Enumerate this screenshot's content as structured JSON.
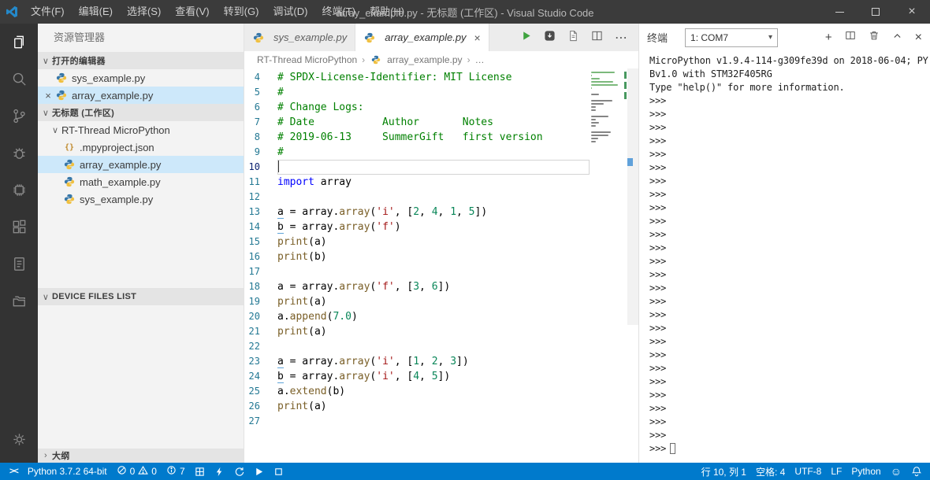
{
  "titlebar": {
    "menus": [
      "文件(F)",
      "编辑(E)",
      "选择(S)",
      "查看(V)",
      "转到(G)",
      "调试(D)",
      "终端(T)",
      "帮助(H)"
    ],
    "title": "array_example.py - 无标题 (工作区) - Visual Studio Code"
  },
  "icons": {
    "close": "×",
    "chevron_down": "∨",
    "chevron_right": "›",
    "breadcrumb_sep": "›",
    "more": "⋯",
    "dropdown_arrow": "▾",
    "json_braces": "{}",
    "plus": "+",
    "smiley": "☺",
    "remote": "><"
  },
  "sidebar": {
    "title": "资源管理器",
    "open_editors": {
      "label": "打开的编辑器",
      "items": [
        {
          "name": "sys_example.py"
        },
        {
          "name": "array_example.py",
          "active": true
        }
      ]
    },
    "workspace": {
      "label": "无标题 (工作区)",
      "folder": "RT-Thread MicroPython",
      "files": [
        ".mpyproject.json",
        "array_example.py",
        "math_example.py",
        "sys_example.py"
      ],
      "selected": "array_example.py"
    },
    "device_section": {
      "label": "DEVICE FILES LIST"
    },
    "outline_section": {
      "label": "大纲"
    }
  },
  "editor": {
    "tabs": [
      {
        "label": "sys_example.py",
        "active": false
      },
      {
        "label": "array_example.py",
        "active": true
      }
    ],
    "breadcrumbs": [
      "RT-Thread MicroPython",
      "array_example.py",
      "…"
    ],
    "code": {
      "first_line": 4,
      "current_line": 10,
      "lines": [
        [
          {
            "t": "cm",
            "s": "# SPDX-License-Identifier: MIT License"
          }
        ],
        [
          {
            "t": "cm",
            "s": "#"
          }
        ],
        [
          {
            "t": "cm",
            "s": "# Change Logs:"
          }
        ],
        [
          {
            "t": "cm",
            "s": "# Date           Author       Notes"
          }
        ],
        [
          {
            "t": "cm",
            "s": "# 2019-06-13     SummerGift   first version"
          }
        ],
        [
          {
            "t": "cm",
            "s": "#"
          }
        ],
        [],
        [
          {
            "t": "kw",
            "s": "import"
          },
          {
            "t": "pl",
            "s": " array"
          }
        ],
        [],
        [
          {
            "t": "pl",
            "s": "a",
            "u": true
          },
          {
            "t": "pl",
            "s": " = array."
          },
          {
            "t": "fn",
            "s": "array"
          },
          {
            "t": "pl",
            "s": "("
          },
          {
            "t": "str",
            "s": "'i'"
          },
          {
            "t": "pl",
            "s": ", ["
          },
          {
            "t": "num",
            "s": "2"
          },
          {
            "t": "pl",
            "s": ", "
          },
          {
            "t": "num",
            "s": "4"
          },
          {
            "t": "pl",
            "s": ", "
          },
          {
            "t": "num",
            "s": "1"
          },
          {
            "t": "pl",
            "s": ", "
          },
          {
            "t": "num",
            "s": "5"
          },
          {
            "t": "pl",
            "s": "])"
          }
        ],
        [
          {
            "t": "pl",
            "s": "b",
            "u": true
          },
          {
            "t": "pl",
            "s": " = array."
          },
          {
            "t": "fn",
            "s": "array"
          },
          {
            "t": "pl",
            "s": "("
          },
          {
            "t": "str",
            "s": "'f'"
          },
          {
            "t": "pl",
            "s": ")"
          }
        ],
        [
          {
            "t": "fn",
            "s": "print"
          },
          {
            "t": "pl",
            "s": "(a)"
          }
        ],
        [
          {
            "t": "fn",
            "s": "print"
          },
          {
            "t": "pl",
            "s": "(b)"
          }
        ],
        [],
        [
          {
            "t": "pl",
            "s": "a = array."
          },
          {
            "t": "fn",
            "s": "array"
          },
          {
            "t": "pl",
            "s": "("
          },
          {
            "t": "str",
            "s": "'f'"
          },
          {
            "t": "pl",
            "s": ", ["
          },
          {
            "t": "num",
            "s": "3"
          },
          {
            "t": "pl",
            "s": ", "
          },
          {
            "t": "num",
            "s": "6"
          },
          {
            "t": "pl",
            "s": "])"
          }
        ],
        [
          {
            "t": "fn",
            "s": "print"
          },
          {
            "t": "pl",
            "s": "(a)"
          }
        ],
        [
          {
            "t": "pl",
            "s": "a."
          },
          {
            "t": "fn",
            "s": "append"
          },
          {
            "t": "pl",
            "s": "("
          },
          {
            "t": "num",
            "s": "7.0"
          },
          {
            "t": "pl",
            "s": ")"
          }
        ],
        [
          {
            "t": "fn",
            "s": "print"
          },
          {
            "t": "pl",
            "s": "(a)"
          }
        ],
        [],
        [
          {
            "t": "pl",
            "s": "a",
            "u": true
          },
          {
            "t": "pl",
            "s": " = array."
          },
          {
            "t": "fn",
            "s": "array"
          },
          {
            "t": "pl",
            "s": "("
          },
          {
            "t": "str",
            "s": "'i'"
          },
          {
            "t": "pl",
            "s": ", ["
          },
          {
            "t": "num",
            "s": "1"
          },
          {
            "t": "pl",
            "s": ", "
          },
          {
            "t": "num",
            "s": "2"
          },
          {
            "t": "pl",
            "s": ", "
          },
          {
            "t": "num",
            "s": "3"
          },
          {
            "t": "pl",
            "s": "])"
          }
        ],
        [
          {
            "t": "pl",
            "s": "b",
            "u": true
          },
          {
            "t": "pl",
            "s": " = array."
          },
          {
            "t": "fn",
            "s": "array"
          },
          {
            "t": "pl",
            "s": "("
          },
          {
            "t": "str",
            "s": "'i'"
          },
          {
            "t": "pl",
            "s": ", ["
          },
          {
            "t": "num",
            "s": "4"
          },
          {
            "t": "pl",
            "s": ", "
          },
          {
            "t": "num",
            "s": "5"
          },
          {
            "t": "pl",
            "s": "])"
          }
        ],
        [
          {
            "t": "pl",
            "s": "a."
          },
          {
            "t": "fn",
            "s": "extend"
          },
          {
            "t": "pl",
            "s": "(b)"
          }
        ],
        [
          {
            "t": "fn",
            "s": "print"
          },
          {
            "t": "pl",
            "s": "(a)"
          }
        ],
        []
      ]
    }
  },
  "panel": {
    "title": "终端",
    "terminal_select": "1: COM7",
    "banner": [
      "MicroPython v1.9.4-114-g309fe39d on 2018-06-04; PY",
      "Bv1.0 with STM32F405RG",
      "Type \"help()\" for more information."
    ],
    "prompt": ">>>",
    "empty_prompt_rows": 26
  },
  "statusbar": {
    "interpreter": "Python 3.7.2 64-bit",
    "errors": "0",
    "warnings": "0",
    "infos": "7",
    "cursor": "行 10, 列 1",
    "indent": "空格: 4",
    "encoding": "UTF-8",
    "eol": "LF",
    "language": "Python"
  },
  "colors": {
    "accent": "#007acc",
    "comment": "#008000",
    "keyword": "#0000ff",
    "string": "#a31515",
    "number": "#098658",
    "function": "#795e26"
  }
}
